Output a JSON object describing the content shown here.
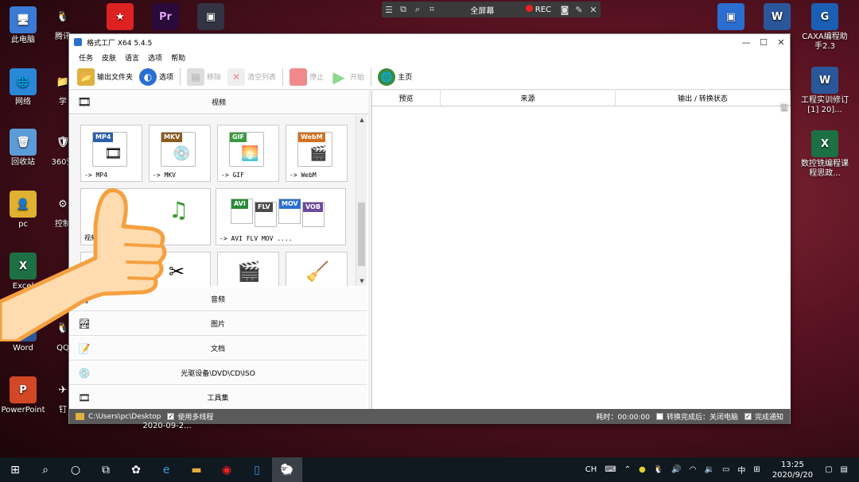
{
  "recorder": {
    "fullscreen_label": "全屏幕",
    "rec_label": "REC"
  },
  "desktop": {
    "left_icons": [
      {
        "label": "此电脑",
        "color": "#3a7bd5",
        "glyph": "🖥"
      },
      {
        "label": "网络",
        "color": "#2a88d8",
        "glyph": "🌐"
      },
      {
        "label": "回收站",
        "color": "#5a9bd8",
        "glyph": "🗑"
      },
      {
        "label": "pc",
        "color": "#e0b030",
        "glyph": "👤"
      },
      {
        "label": "Excel",
        "color": "#1d7044",
        "glyph": "X"
      },
      {
        "label": "Word",
        "color": "#2b579a",
        "glyph": "W"
      },
      {
        "label": "PowerPoint",
        "color": "#d24726",
        "glyph": "P"
      }
    ],
    "second_col": [
      {
        "label": "腾讯",
        "glyph": "🐧"
      },
      {
        "label": "学",
        "glyph": "📁"
      },
      {
        "label": "360安",
        "glyph": "🛡"
      },
      {
        "label": "控制",
        "glyph": "⚙"
      },
      {
        "label": "QQ",
        "glyph": "🐧"
      },
      {
        "label": "钉",
        "glyph": "✈"
      }
    ],
    "right_icons": [
      {
        "label": "CAXA编程助手2.3",
        "color": "#1a5fb4",
        "glyph": "G"
      },
      {
        "label": "工程实训修订[1] 20]...",
        "color": "#2b579a",
        "glyph": "W"
      },
      {
        "label": "数控铣编程课程思政...",
        "color": "#1d7044",
        "glyph": "X"
      }
    ],
    "partial_labels": [
      "笛",
      "2020-09-2..."
    ]
  },
  "window": {
    "title": "格式工厂 X64 5.4.5",
    "menu": [
      "任务",
      "皮肤",
      "语言",
      "选项",
      "帮助"
    ],
    "toolbar": {
      "output_folder": "输出文件夹",
      "options": "选项",
      "remove": "移除",
      "clear_list": "清空列表",
      "stop": "停止",
      "start": "开始",
      "home": "主页"
    },
    "video_category": "视频",
    "tiles": [
      {
        "tag": "MP4",
        "tag_color": "#2a5fa8",
        "label": "-> MP4",
        "glyph": "🎞"
      },
      {
        "tag": "MKV",
        "tag_color": "#8a5a20",
        "label": "-> MKV",
        "glyph": "💿"
      },
      {
        "tag": "GIF",
        "tag_color": "#3a9a40",
        "label": "-> GIF",
        "glyph": "🌅"
      },
      {
        "tag": "WebM",
        "tag_color": "#d07020",
        "label": "-> WebM",
        "glyph": "🎬"
      }
    ],
    "wide_tiles": [
      {
        "label": "视频",
        "glyph": "🎞"
      },
      {
        "label": "-> AVI FLV MOV ....",
        "tags": [
          "AVI",
          "FLV",
          "MOV",
          "VOB"
        ]
      }
    ],
    "categories": [
      {
        "label": "音频",
        "glyph": "🎵"
      },
      {
        "label": "图片",
        "glyph": "🏞"
      },
      {
        "label": "文档",
        "glyph": "📝"
      },
      {
        "label": "光驱设备\\DVD\\CD\\ISO",
        "glyph": "💿"
      },
      {
        "label": "工具集",
        "glyph": "🎞"
      }
    ],
    "table_headers": [
      "预览",
      "来源",
      "输出 / 转换状态"
    ],
    "status": {
      "path": "C:\\Users\\pc\\Desktop",
      "multithread": "使用多线程",
      "elapsed": "耗时：00:00:00",
      "after_convert": "转换完成后：关闭电脑",
      "notify": "完成通知"
    }
  },
  "taskbar": {
    "lang": "CH",
    "ime": "中",
    "time": "13:25",
    "date": "2020/9/20"
  }
}
